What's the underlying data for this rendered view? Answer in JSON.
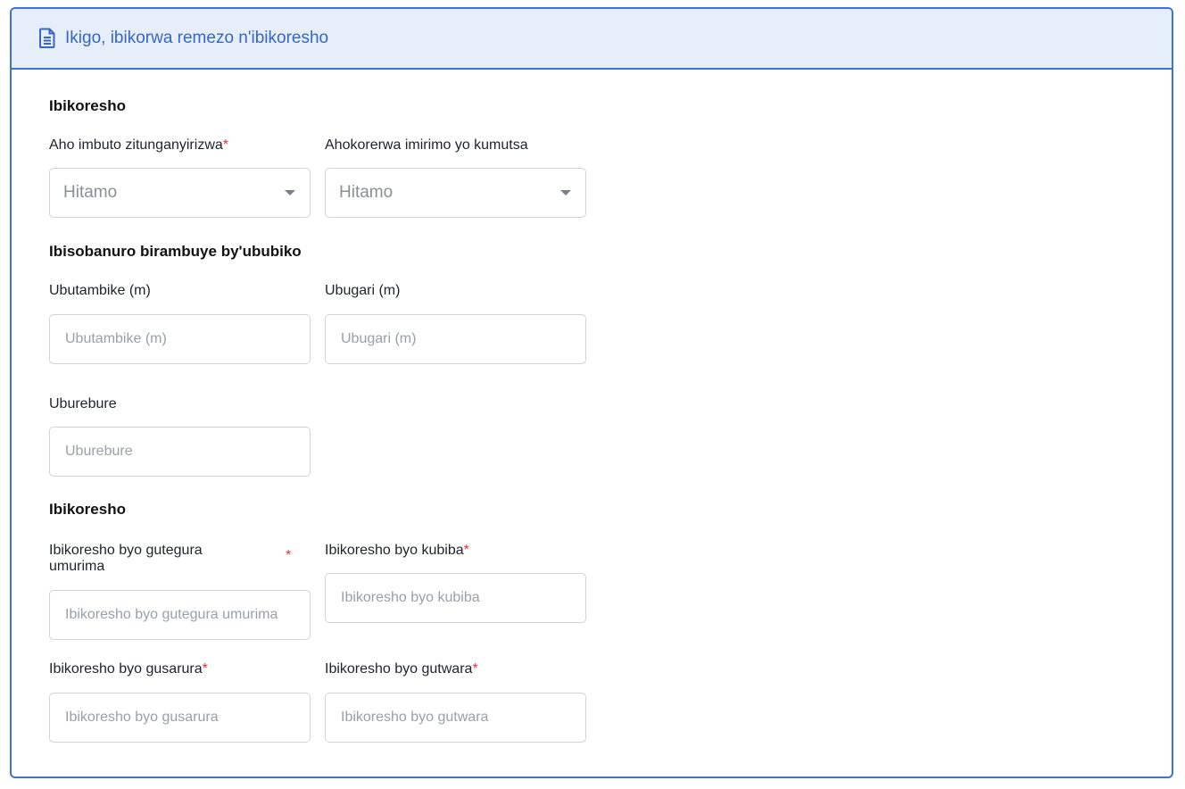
{
  "header": {
    "title": "Ikigo, ibikorwa remezo n'ibikoresho",
    "icon": "document-icon"
  },
  "sections": {
    "equipment_top": {
      "title": "Ibikoresho"
    },
    "dimensions": {
      "title": "Ibisobanuro birambuye by'ububiko"
    },
    "equipment_bottom": {
      "title": "Ibikoresho"
    }
  },
  "fields": {
    "planting_place": {
      "label": "Aho imbuto zitunganyirizwa",
      "required": "*",
      "value": "Hitamo"
    },
    "drying_place": {
      "label": "Ahokorerwa imirimo yo kumutsa",
      "value": "Hitamo"
    },
    "width": {
      "label": "Ubutambike (m)",
      "placeholder": "Ubutambike (m)"
    },
    "height": {
      "label": "Ubugari (m)",
      "placeholder": "Ubugari (m)"
    },
    "length": {
      "label": "Uburebure",
      "placeholder": "Uburebure"
    },
    "field_prep_tools": {
      "label": "Ibikoresho byo gutegura umurima",
      "required": "*",
      "placeholder": "Ibikoresho byo gutegura umurima"
    },
    "digging_tools": {
      "label": "Ibikoresho byo kubiba",
      "required": "*",
      "placeholder": "Ibikoresho byo kubiba"
    },
    "harvest_tools": {
      "label": "Ibikoresho byo gusarura",
      "required": "*",
      "placeholder": "Ibikoresho byo gusarura"
    },
    "transport_tools": {
      "label": "Ibikoresho byo gutwara",
      "required": "*",
      "placeholder": "Ibikoresho byo gutwara"
    }
  },
  "colors": {
    "accent": "#3d73d4",
    "header_bg": "#e6eef9",
    "required": "#e0343b"
  }
}
